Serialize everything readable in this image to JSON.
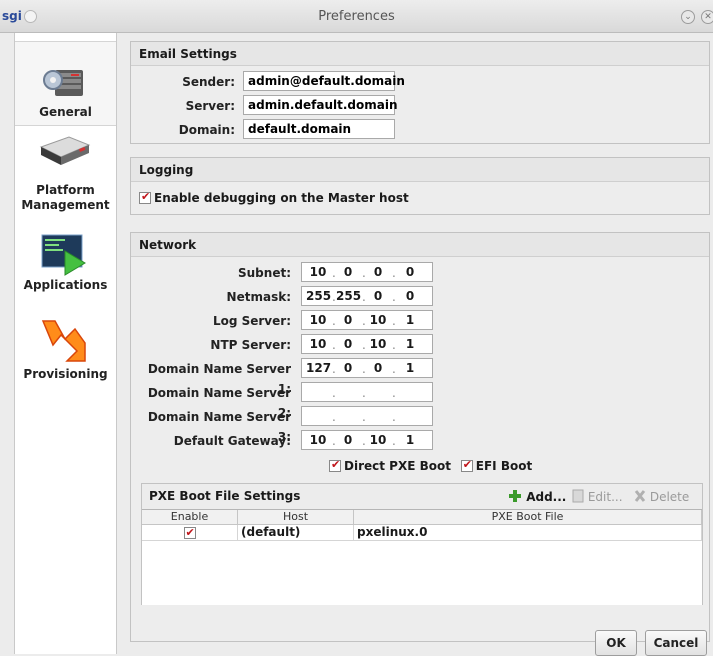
{
  "window": {
    "app_badge": "sgi",
    "title": "Preferences"
  },
  "sidebar": {
    "items": [
      {
        "label": "General",
        "icon": "server-rack-gear-icon",
        "active": true
      },
      {
        "label": "Platform Management",
        "icon": "server-blade-icon",
        "active": false
      },
      {
        "label": "Applications",
        "icon": "terminal-play-icon",
        "active": false
      },
      {
        "label": "Provisioning",
        "icon": "orange-arrow-icon",
        "active": false
      }
    ]
  },
  "email": {
    "heading": "Email Settings",
    "sender_label": "Sender:",
    "sender_value": "admin@default.domain",
    "server_label": "Server:",
    "server_value": "admin.default.domain",
    "domain_label": "Domain:",
    "domain_value": "default.domain"
  },
  "logging": {
    "heading": "Logging",
    "debug_label": "Enable debugging on the Master host",
    "debug_checked": true
  },
  "network": {
    "heading": "Network",
    "fields": [
      {
        "label": "Subnet:",
        "octets": [
          "10",
          "0",
          "0",
          "0"
        ]
      },
      {
        "label": "Netmask:",
        "octets": [
          "255",
          "255",
          "0",
          "0"
        ]
      },
      {
        "label": "Log Server:",
        "octets": [
          "10",
          "0",
          "10",
          "1"
        ]
      },
      {
        "label": "NTP Server:",
        "octets": [
          "10",
          "0",
          "10",
          "1"
        ]
      },
      {
        "label": "Domain Name Server 1:",
        "octets": [
          "127",
          "0",
          "0",
          "1"
        ]
      },
      {
        "label": "Domain Name Server 2:",
        "octets": [
          "",
          "",
          "",
          ""
        ]
      },
      {
        "label": "Domain Name Server 3:",
        "octets": [
          "",
          "",
          "",
          ""
        ]
      },
      {
        "label": "Default Gateway:",
        "octets": [
          "10",
          "0",
          "10",
          "1"
        ]
      }
    ],
    "direct_pxe_label": "Direct PXE Boot",
    "efi_label": "EFI Boot"
  },
  "pxe": {
    "heading": "PXE Boot File Settings",
    "add_label": "Add...",
    "edit_label": "Edit...",
    "delete_label": "Delete",
    "columns": [
      "Enable",
      "Host",
      "PXE Boot File"
    ],
    "rows": [
      {
        "enabled": true,
        "host": "(default)",
        "file": "pxelinux.0"
      }
    ]
  },
  "footer": {
    "ok_label": "OK",
    "cancel_label": "Cancel"
  },
  "colors": {
    "check_red": "#c0141a",
    "add_green": "#3a9a2a"
  }
}
